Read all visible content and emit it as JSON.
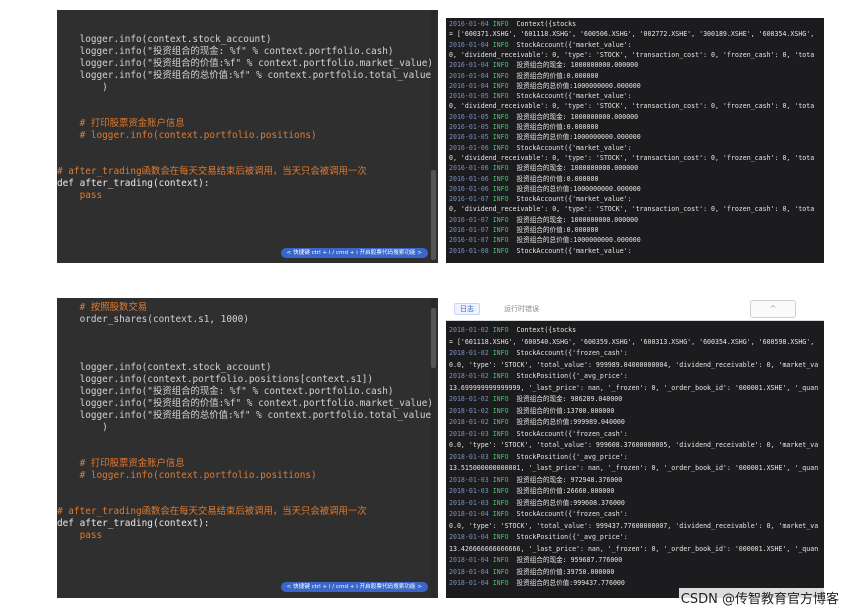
{
  "top_code": {
    "lines": [
      "    logger.info(context.stock_account)",
      "    logger.info(\"投资组合的现金: %f\" % context.portfolio.cash)",
      "    logger.info(\"投资组合的价值:%f\" % context.portfolio.market_value)",
      "    logger.info(\"投资组合的总价值:%f\" % context.portfolio.total_value",
      "        )",
      "",
      "",
      "    # 打印股票资金账户信息",
      "    # logger.info(context.portfolio.positions)",
      "",
      "",
      "# after_trading函数会在每天交易结束后被调用，当天只会被调用一次",
      "def after_trading(context):",
      "    pass"
    ],
    "hint": "< 快捷键 ctrl + i / cmd + i 开启股票代码搜索功能 >"
  },
  "top_log": {
    "lines": [
      [
        "2016-01-04",
        "INFO",
        "Context({stocks"
      ],
      [
        "",
        "",
        "= ['600371.XSHG', '601118.XSHG', '600506.XSHG', '002772.XSHE', '300189.XSHE', '600354.XSHG',"
      ],
      [
        "2016-01-04",
        "INFO",
        "StockAccount({'market_value':"
      ],
      [
        "",
        "",
        "0, 'dividend_receivable': 0, 'type': 'STOCK', 'transaction_cost': 0, 'frozen_cash': 0, 'tota"
      ],
      [
        "2016-01-04",
        "INFO",
        "投资组合的现金: 1000000000.000000"
      ],
      [
        "2016-01-04",
        "INFO",
        "投资组合的价值:0.000000"
      ],
      [
        "2016-01-04",
        "INFO",
        "投资组合的总价值:1000000000.000000"
      ],
      [
        "2016-01-05",
        "INFO",
        "StockAccount({'market_value':"
      ],
      [
        "",
        "",
        "0, 'dividend_receivable': 0, 'type': 'STOCK', 'transaction_cost': 0, 'frozen_cash': 0, 'tota"
      ],
      [
        "2016-01-05",
        "INFO",
        "投资组合的现金: 1000000000.000000"
      ],
      [
        "2016-01-05",
        "INFO",
        "投资组合的价值:0.000000"
      ],
      [
        "2016-01-05",
        "INFO",
        "投资组合的总价值:1000000000.000000"
      ],
      [
        "2016-01-06",
        "INFO",
        "StockAccount({'market_value':"
      ],
      [
        "",
        "",
        "0, 'dividend_receivable': 0, 'type': 'STOCK', 'transaction_cost': 0, 'frozen_cash': 0, 'tota"
      ],
      [
        "2016-01-06",
        "INFO",
        "投资组合的现金: 1000000000.000000"
      ],
      [
        "2016-01-06",
        "INFO",
        "投资组合的价值:0.000000"
      ],
      [
        "2016-01-06",
        "INFO",
        "投资组合的总价值:1000000000.000000"
      ],
      [
        "2016-01-07",
        "INFO",
        "StockAccount({'market_value':"
      ],
      [
        "",
        "",
        "0, 'dividend_receivable': 0, 'type': 'STOCK', 'transaction_cost': 0, 'frozen_cash': 0, 'tota"
      ],
      [
        "2016-01-07",
        "INFO",
        "投资组合的现金: 1000000000.000000"
      ],
      [
        "2016-01-07",
        "INFO",
        "投资组合的价值:0.000000"
      ],
      [
        "2016-01-07",
        "INFO",
        "投资组合的总价值:1000000000.000000"
      ],
      [
        "2016-01-08",
        "INFO",
        "StockAccount({'market_value':"
      ]
    ]
  },
  "bottom_code": {
    "lines": [
      "    # 按照股数交易",
      "    order_shares(context.s1, 1000)",
      "",
      "",
      "",
      "    logger.info(context.stock_account)",
      "    logger.info(context.portfolio.positions[context.s1])",
      "    logger.info(\"投资组合的现金: %f\" % context.portfolio.cash)",
      "    logger.info(\"投资组合的价值:%f\" % context.portfolio.market_value)",
      "    logger.info(\"投资组合的总价值:%f\" % context.portfolio.total_value",
      "        )",
      "",
      "",
      "    # 打印股票资金账户信息",
      "    # logger.info(context.portfolio.positions)",
      "",
      "",
      "# after_trading函数会在每天交易结束后被调用，当天只会被调用一次",
      "def after_trading(context):",
      "    pass"
    ],
    "hint": "< 快捷键 ctrl + i / cmd + i 开启股票代码搜索功能 >"
  },
  "bottom_log": {
    "tabs": [
      "日志",
      "运行时错误"
    ],
    "collapse_symbol": "^",
    "lines": [
      [
        "2018-01-02",
        "INFO",
        "Context({stocks"
      ],
      [
        "",
        "",
        "= ['601118.XSHG', '600540.XSHG', '600359.XSHG', '600313.XSHG', '600354.XSHG', '600598.XSHG',"
      ],
      [
        "2018-01-02",
        "INFO",
        "StockAccount({'frozen_cash':"
      ],
      [
        "",
        "",
        "0.0, 'type': 'STOCK', 'total_value': 999989.04000000004, 'dividend_receivable': 0, 'market_va"
      ],
      [
        "2018-01-02",
        "INFO",
        "StockPosition({'_avg_price':"
      ],
      [
        "",
        "",
        "13.699999999999999, '_last_price': nan, '_frozen': 0, '_order_book_id': '000001.XSHE', '_quan"
      ],
      [
        "2018-01-02",
        "INFO",
        "投资组合的现金: 986289.040000"
      ],
      [
        "2018-01-02",
        "INFO",
        "投资组合的价值:13700.000000"
      ],
      [
        "2018-01-02",
        "INFO",
        "投资组合的总价值:999989.040000"
      ],
      [
        "2018-01-03",
        "INFO",
        "StockAccount({'frozen_cash':"
      ],
      [
        "",
        "",
        "0.0, 'type': 'STOCK', 'total_value': 999608.37600000005, 'dividend_receivable': 0, 'market_va"
      ],
      [
        "2018-01-03",
        "INFO",
        "StockPosition({'_avg_price':"
      ],
      [
        "",
        "",
        "13.515000000000001, '_last_price': nan, '_frozen': 0, '_order_book_id': '000001.XSHE', '_quan"
      ],
      [
        "2018-01-03",
        "INFO",
        "投资组合的现金: 972948.376000"
      ],
      [
        "2018-01-03",
        "INFO",
        "投资组合的价值:26660.000000"
      ],
      [
        "2018-01-03",
        "INFO",
        "投资组合的总价值:999608.376000"
      ],
      [
        "2018-01-04",
        "INFO",
        "StockAccount({'frozen_cash':"
      ],
      [
        "",
        "",
        "0.0, 'type': 'STOCK', 'total_value': 999437.77600000007, 'dividend_receivable': 0, 'market_va"
      ],
      [
        "2018-01-04",
        "INFO",
        "StockPosition({'_avg_price':"
      ],
      [
        "",
        "",
        "13.426666666666666, '_last_price': nan, '_frozen': 0, '_order_book_id': '000001.XSHE', '_quan"
      ],
      [
        "2018-01-04",
        "INFO",
        "投资组合的现金: 959687.776000"
      ],
      [
        "2018-01-04",
        "INFO",
        "投资组合的价值:39750.000000"
      ],
      [
        "2018-01-04",
        "INFO",
        "投资组合的总价值:999437.776000"
      ]
    ]
  },
  "watermark": "CSDN @传智教育官方博客",
  "colors": {
    "code_bg": "#2f2f30",
    "log_bg": "#1c1c1f",
    "comment": "#e07a2f",
    "timestamp": "#7c8fbd",
    "info": "#4ac06f",
    "hint_bg": "#3a66c9",
    "number": "#7aa6da"
  }
}
